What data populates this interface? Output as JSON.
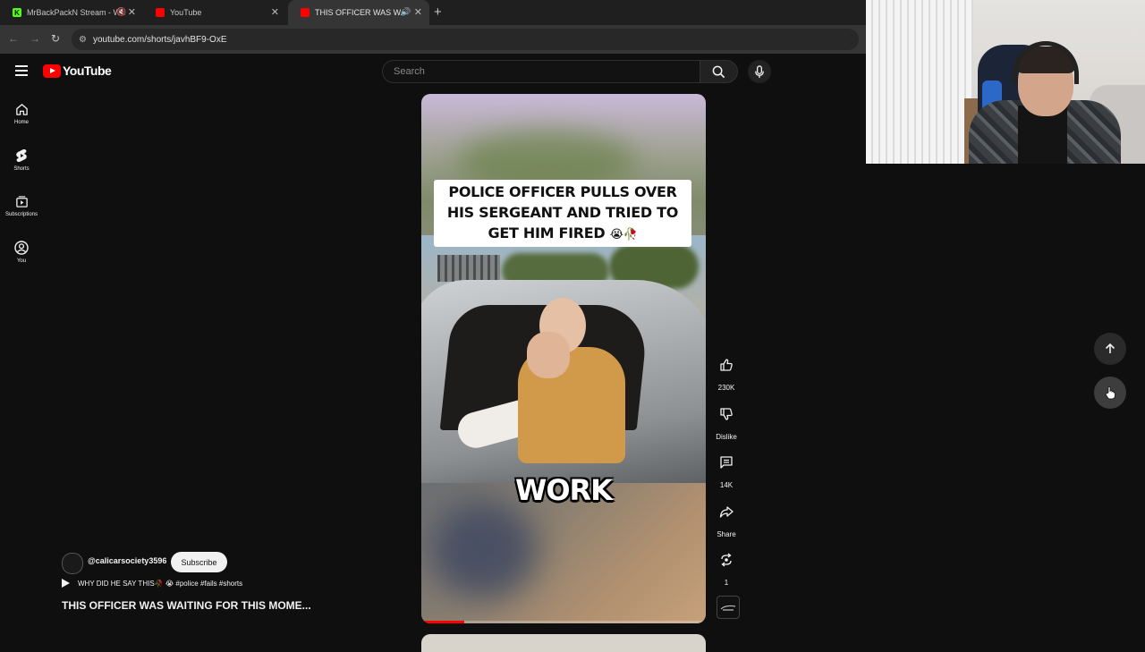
{
  "browser": {
    "tabs": [
      {
        "title": "MrBackPackN Stream - Wa",
        "favicon_color": "#53fc18",
        "active": false
      },
      {
        "title": "YouTube",
        "favicon_color": "#ff0000",
        "active": false
      },
      {
        "title": "THIS OFFICER WAS WAITIN",
        "favicon_color": "#ff0000",
        "active": true
      }
    ],
    "url": "youtube.com/shorts/javhBF9-OxE"
  },
  "header": {
    "logo_text": "YouTube",
    "search_placeholder": "Search"
  },
  "sidebar": {
    "items": [
      {
        "label": "Home",
        "icon": "home-icon"
      },
      {
        "label": "Shorts",
        "icon": "shorts-icon"
      },
      {
        "label": "Subscriptions",
        "icon": "subscriptions-icon"
      },
      {
        "label": "You",
        "icon": "you-icon"
      }
    ]
  },
  "video": {
    "caption_text": "POLICE OFFICER PULLS OVER HIS SERGEANT AND TRIED TO GET HIM FIRED",
    "caption_emoji": "😭🥀",
    "subtitle_word": "WORK",
    "progress": 0.15
  },
  "actions": {
    "like_count": "230K",
    "dislike_label": "Dislike",
    "comments_count": "14K",
    "share_label": "Share",
    "remix_count": "1"
  },
  "channel": {
    "handle": "@calicarsociety3596",
    "subscribe_label": "Subscribe",
    "description": "WHY DID HE SAY THIS🥀 😭 #police #fails #shorts",
    "title": "THIS OFFICER WAS WAITING FOR THIS MOME..."
  },
  "colors": {
    "accent": "#ff0000",
    "background": "#0f0f0f",
    "kick_green": "#53fc18"
  }
}
